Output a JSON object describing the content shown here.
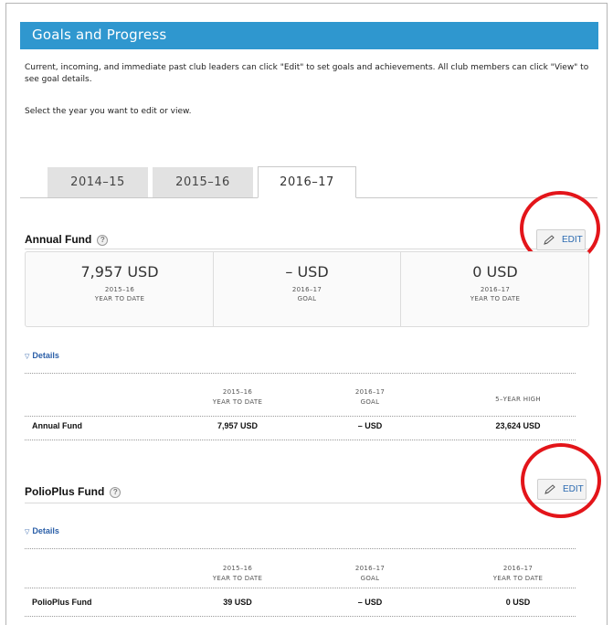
{
  "header": {
    "title": "Goals and Progress"
  },
  "intro": {
    "text": "Current, incoming, and immediate past club leaders can click \"Edit\" to set goals and achievements. All club members can click \"View\" to see goal details.",
    "select_year": "Select the year you want to edit or view."
  },
  "tabs": [
    {
      "label": "2014–15",
      "active": false
    },
    {
      "label": "2015–16",
      "active": false
    },
    {
      "label": "2016–17",
      "active": true
    }
  ],
  "annual_fund": {
    "title": "Annual Fund",
    "help_glyph": "?",
    "edit_label": "EDIT",
    "summary": [
      {
        "amount": "7,957 USD",
        "year": "2015–16",
        "caption": "YEAR TO DATE"
      },
      {
        "amount": "– USD",
        "year": "2016–17",
        "caption": "GOAL"
      },
      {
        "amount": "0 USD",
        "year": "2016–17",
        "caption": "YEAR TO DATE"
      }
    ],
    "details_label": "Details",
    "table": {
      "headers": [
        {
          "line1": "2015–16",
          "line2": "YEAR TO DATE"
        },
        {
          "line1": "2016–17",
          "line2": "GOAL"
        },
        {
          "line1": "",
          "line2": "5–YEAR HIGH"
        }
      ],
      "row": {
        "label": "Annual Fund",
        "values": [
          "7,957 USD",
          "– USD",
          "23,624 USD"
        ]
      }
    }
  },
  "polioplus_fund": {
    "title": "PolioPlus Fund",
    "help_glyph": "?",
    "edit_label": "EDIT",
    "details_label": "Details",
    "table": {
      "headers": [
        {
          "line1": "2015–16",
          "line2": "YEAR TO DATE"
        },
        {
          "line1": "2016–17",
          "line2": "GOAL"
        },
        {
          "line1": "2016–17",
          "line2": "YEAR TO DATE"
        }
      ],
      "row": {
        "label": "PolioPlus Fund",
        "values": [
          "39 USD",
          "– USD",
          "0 USD"
        ]
      }
    }
  },
  "colors": {
    "header_bg": "#2f97cf",
    "link": "#2b5fa8",
    "highlight_circle": "#e3151a"
  }
}
